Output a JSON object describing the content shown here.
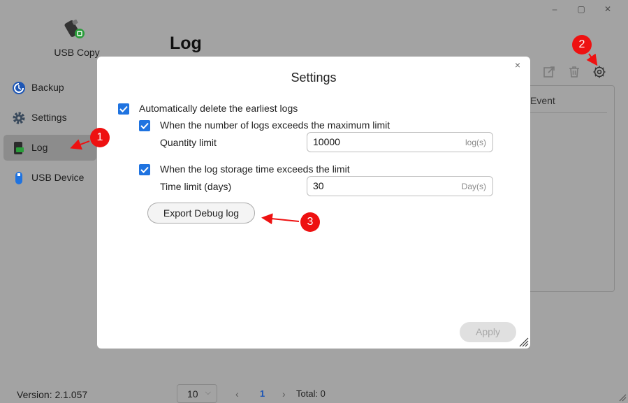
{
  "window": {
    "controls": {
      "minimize": "–",
      "maximize": "▢",
      "close": "✕"
    }
  },
  "sidebar": {
    "app_name": "USB Copy",
    "items": [
      {
        "label": "Backup",
        "icon": "backup-icon"
      },
      {
        "label": "Settings",
        "icon": "gear-icon"
      },
      {
        "label": "Log",
        "icon": "log-icon",
        "active": true
      },
      {
        "label": "USB Device",
        "icon": "usb-device-icon"
      }
    ],
    "version": "Version: 2.1.057"
  },
  "main": {
    "title": "Log",
    "table": {
      "columns": [
        "Event"
      ]
    },
    "pagination": {
      "page_size": "10",
      "current_page": "1",
      "total": "Total: 0"
    }
  },
  "dialog": {
    "title": "Settings",
    "close": "×",
    "auto_delete_label": "Automatically delete the earliest logs",
    "auto_delete_checked": true,
    "max_count_label": "When the number of logs exceeds the maximum limit",
    "max_count_checked": true,
    "quantity_label": "Quantity limit",
    "quantity_value": "10000",
    "quantity_unit": "log(s)",
    "time_label": "When the log storage time exceeds the limit",
    "time_checked": true,
    "time_limit_label": "Time limit (days)",
    "time_value": "30",
    "time_unit": "Day(s)",
    "export_button": "Export Debug log",
    "apply_button": "Apply"
  },
  "annotations": {
    "marker1": "1",
    "marker2": "2",
    "marker3": "3"
  },
  "colors": {
    "accent": "#1f73e0",
    "annotation": "#ee1111",
    "link": "#1d56b5"
  }
}
